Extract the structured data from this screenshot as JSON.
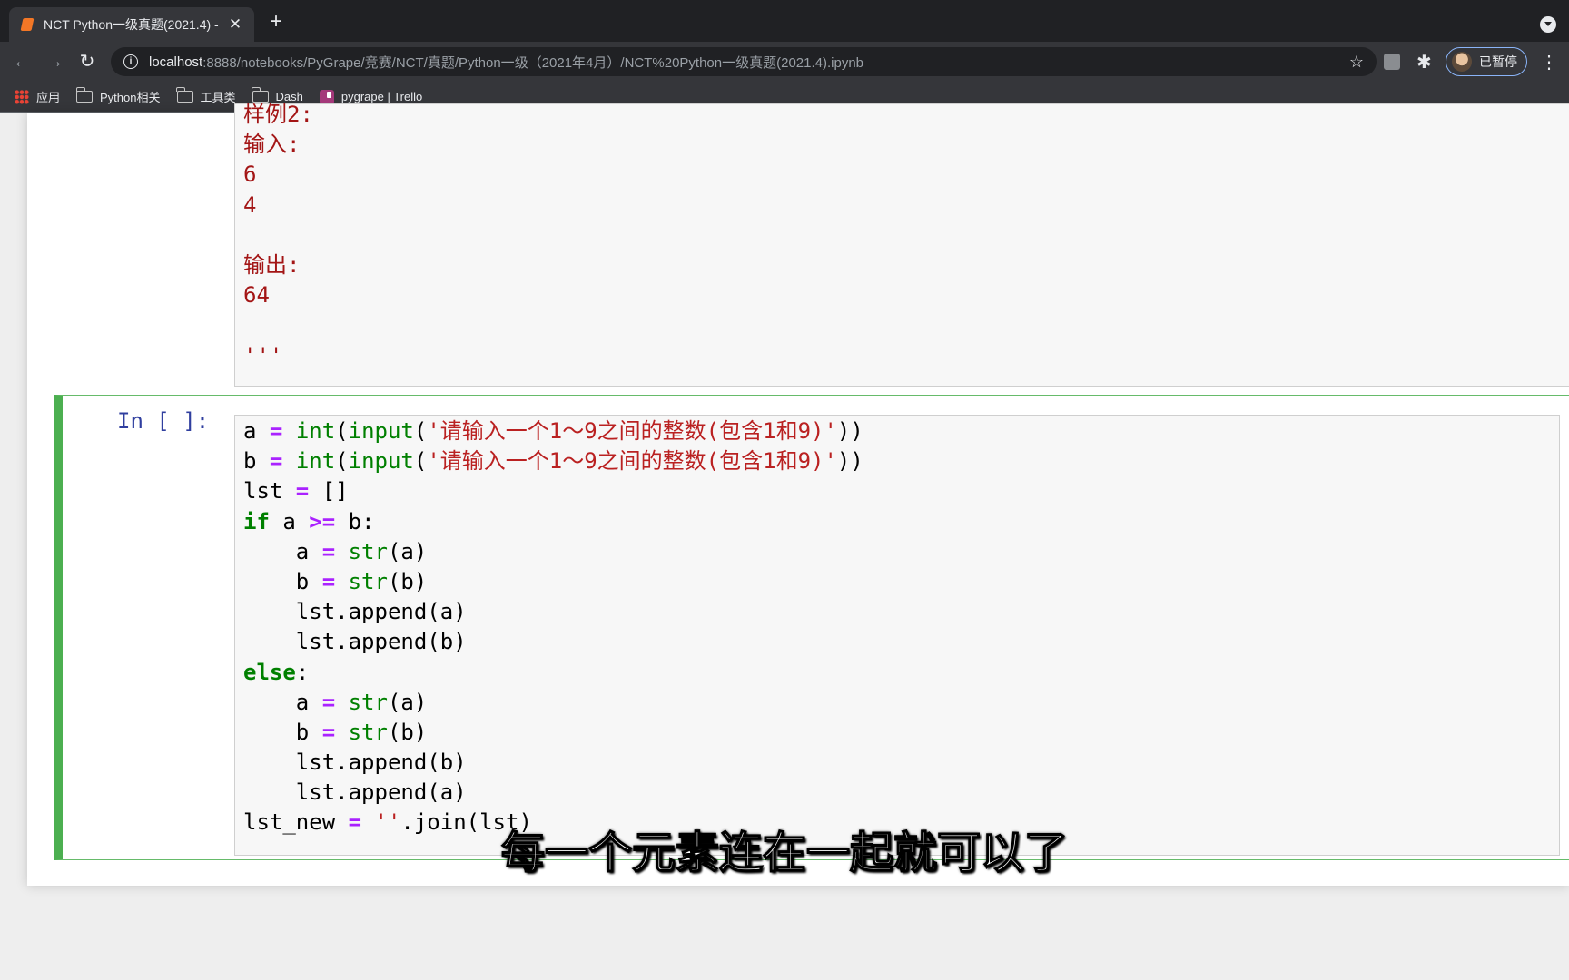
{
  "browser": {
    "tab_title": "NCT Python一级真题(2021.4) -",
    "tab_close": "✕",
    "new_tab": "+",
    "url_host": "localhost",
    "url_path": ":8888/notebooks/PyGrape/竞赛/NCT/真题/Python一级（2021年4月）/NCT%20Python一级真题(2021.4).ipynb",
    "profile_label": "已暂停"
  },
  "bookmarks": [
    {
      "label": "应用",
      "icon": "apps-icon"
    },
    {
      "label": "Python相关",
      "icon": "folder-icon"
    },
    {
      "label": "工具类",
      "icon": "folder-icon"
    },
    {
      "label": "Dash",
      "icon": "folder-icon"
    },
    {
      "label": "pygrape | Trello",
      "icon": "trello-icon"
    }
  ],
  "prev_cell_lines": [
    "样例2:",
    "输入:",
    "6",
    "4",
    "",
    "输出:",
    "64",
    "",
    "'''"
  ],
  "code_cell": {
    "prompt": "In [ ]:"
  },
  "subtitle": "每一个元素连在一起就可以了"
}
